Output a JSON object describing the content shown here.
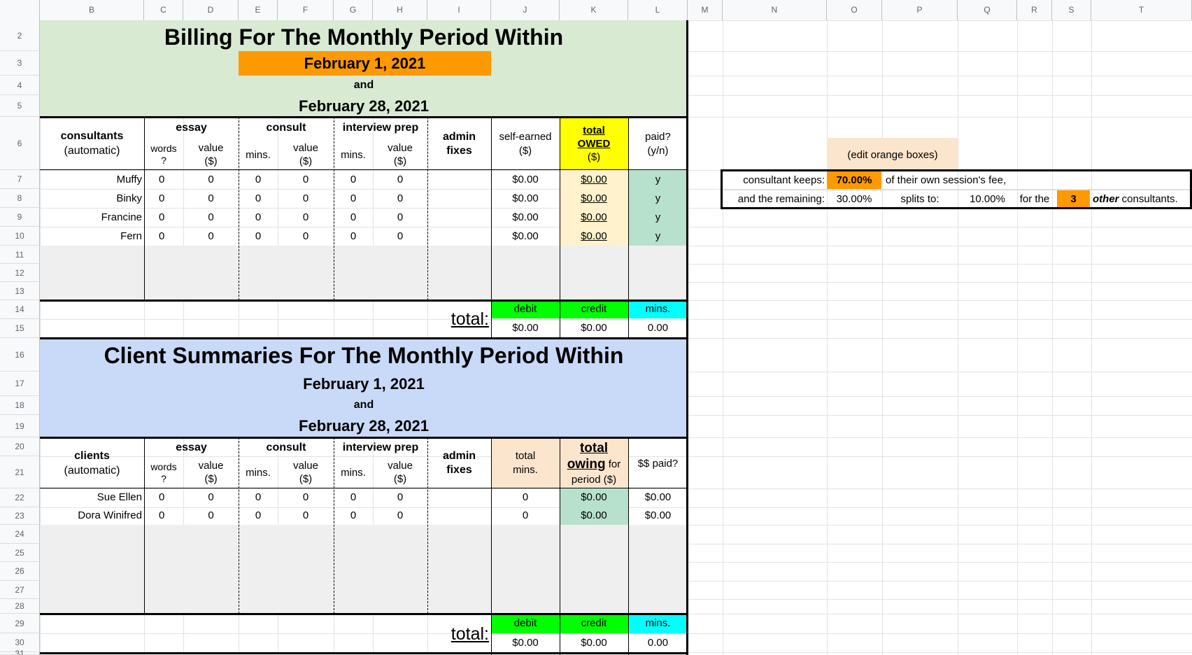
{
  "column_headers": [
    "B",
    "C",
    "D",
    "E",
    "F",
    "G",
    "H",
    "I",
    "J",
    "K",
    "L",
    "M",
    "N",
    "O",
    "P",
    "Q",
    "R",
    "S",
    "T"
  ],
  "row_numbers": [
    "2",
    "3",
    "4",
    "5",
    "6",
    "7",
    "8",
    "9",
    "10",
    "11",
    "12",
    "13",
    "14",
    "15",
    "16",
    "17",
    "18",
    "19",
    "20",
    "21",
    "22",
    "23",
    "24",
    "25",
    "26",
    "27",
    "28",
    "29",
    "30",
    "31"
  ],
  "billing": {
    "title": "Billing For The Monthly Period Within",
    "start_date": "February 1, 2021",
    "and": "and",
    "end_date": "February 28, 2021",
    "headers": {
      "consultants": "consultants",
      "automatic": "(automatic)",
      "essay": "essay",
      "consult": "consult",
      "interview_prep": "interview prep",
      "admin_fixes_1": "admin",
      "admin_fixes_2": "fixes",
      "words_1": "words",
      "words_2": "?",
      "value_1": "value",
      "value_2": "($)",
      "mins": "mins.",
      "self_earned_1": "self-earned",
      "self_earned_2": "($)",
      "total_owed_1": "total",
      "total_owed_2": "OWED",
      "total_owed_3": "($)",
      "paid_1": "paid?",
      "paid_2": "(y/n)"
    },
    "rows": [
      {
        "name": "Muffy",
        "words": "0",
        "essay_value": "0",
        "consult_mins": "0",
        "consult_value": "0",
        "ip_mins": "0",
        "ip_value": "0",
        "self_earned": "$0.00",
        "owed": "$0.00",
        "paid": "y"
      },
      {
        "name": "Binky",
        "words": "0",
        "essay_value": "0",
        "consult_mins": "0",
        "consult_value": "0",
        "ip_mins": "0",
        "ip_value": "0",
        "self_earned": "$0.00",
        "owed": "$0.00",
        "paid": "y"
      },
      {
        "name": "Francine",
        "words": "0",
        "essay_value": "0",
        "consult_mins": "0",
        "consult_value": "0",
        "ip_mins": "0",
        "ip_value": "0",
        "self_earned": "$0.00",
        "owed": "$0.00",
        "paid": "y"
      },
      {
        "name": "Fern",
        "words": "0",
        "essay_value": "0",
        "consult_mins": "0",
        "consult_value": "0",
        "ip_mins": "0",
        "ip_value": "0",
        "self_earned": "$0.00",
        "owed": "$0.00",
        "paid": "y"
      }
    ],
    "total_label": "total:",
    "debit_label": "debit",
    "credit_label": "credit",
    "mins_label": "mins.",
    "debit": "$0.00",
    "credit": "$0.00",
    "mins_total": "0.00"
  },
  "client": {
    "title": "Client Summaries For The Monthly Period Within",
    "start_date": "February 1, 2021",
    "and": "and",
    "end_date": "February 28, 2021",
    "headers": {
      "clients": "clients",
      "automatic": "(automatic)",
      "essay": "essay",
      "consult": "consult",
      "interview_prep": "interview prep",
      "admin_fixes_1": "admin",
      "admin_fixes_2": "fixes",
      "words_1": "words",
      "words_2": "?",
      "value_1": "value",
      "value_2": "($)",
      "mins": "mins.",
      "total_mins_1": "total",
      "total_mins_2": "mins.",
      "owing_1": "total",
      "owing_2": "owing",
      "owing_3": " for",
      "owing_4": "period ($)",
      "paid": "$$ paid?"
    },
    "rows": [
      {
        "name": "Sue Ellen",
        "words": "0",
        "essay_value": "0",
        "consult_mins": "0",
        "consult_value": "0",
        "ip_mins": "0",
        "ip_value": "0",
        "total_mins": "0",
        "owing": "$0.00",
        "paid": "$0.00"
      },
      {
        "name": "Dora Winifred",
        "words": "0",
        "essay_value": "0",
        "consult_mins": "0",
        "consult_value": "0",
        "ip_mins": "0",
        "ip_value": "0",
        "total_mins": "0",
        "owing": "$0.00",
        "paid": "$0.00"
      }
    ],
    "total_label": "total:",
    "debit_label": "debit",
    "credit_label": "credit",
    "mins_label": "mins.",
    "debit": "$0.00",
    "credit": "$0.00",
    "mins_total": "0.00"
  },
  "settings": {
    "edit_note": "(edit orange boxes)",
    "consultant_keeps_label": "consultant keeps:",
    "consultant_keeps_value": "70.00%",
    "own_fee_text": "of their own session's fee,",
    "remaining_label": "and the remaining:",
    "remaining_value": "30.00%",
    "splits_to_label": "splits to:",
    "split_value": "10.00%",
    "for_the_label": "for the",
    "other_count": "3",
    "other_word": "other",
    "consultants_word": " consultants."
  },
  "colors": {
    "header_green": "#d9ead3",
    "header_blue": "#c9daf8",
    "orange": "#ff9900",
    "yellow": "#ffff00",
    "peach": "#fce5cd",
    "light_orange": "#fff2cc",
    "paid_green": "#b7e1cd",
    "debit_green": "#00ff00",
    "mins_cyan": "#00ffff",
    "empty_gray": "#efefef"
  }
}
